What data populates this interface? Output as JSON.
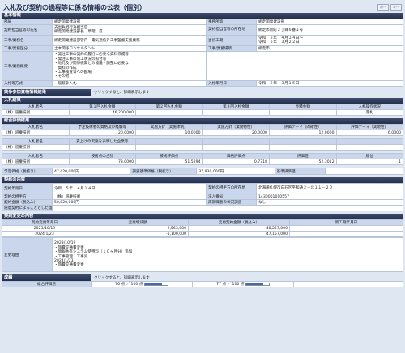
{
  "header": {
    "title": "入札及び契約の過程等に係る情報の公表（個別）",
    "prev_label": "前へ",
    "next_label": "次へ"
  },
  "basic_info": {
    "section_title": "基本情報",
    "bureau_label": "部局",
    "bureau_value": "網走開発建設部",
    "office_label": "事務所等",
    "office_value": "網走開発建設部",
    "official_label": "契約担当官等の氏名",
    "official_value": "支出負担行為担当官\n網走開発建設部長　草階　忍",
    "address_label": "契約担当官等の所在地",
    "address_value": "網走市新町２丁目６番１号",
    "work_name_label": "工事/業務名",
    "work_name_value": "網走開発建設部管内　電気通信外工事監督支援業務",
    "period_label": "当初工期",
    "period_value": "令和　５年　４月１４日～\n令和　６年　３月２２日",
    "type_label": "工事/業務区分",
    "type_value": "土木関係コンサルタント",
    "place_label": "工事/業務場所",
    "place_value": "網走市",
    "outline_label": "工事/業務概要",
    "outline_items": [
      "・発注工事の契約の履行に必要な資料作成等",
      "・発注工事の施工状況の照合等",
      "・地元及び関係機関との協議・調整に必要な",
      "　資料の作成",
      "・工事検査等への臨場",
      "・その他"
    ],
    "bid_method_label": "入札等方式",
    "bid_method_value": "一般競争入札",
    "bid_date_label": "入札年月日",
    "bid_date_value": "令和　５年　３月１５日"
  },
  "competition": {
    "section_title": "競争参加資格情報結果",
    "note": "クリックすると、詳細表示します"
  },
  "bid_results": {
    "section_title": "入札結果",
    "headers": [
      "入札者名",
      "第１回入札金額",
      "第２回入札金額",
      "第３回入札金額",
      "見積金額",
      "入札操作状況"
    ],
    "rows": [
      [
        "（株）道慶技術",
        "46,200,000",
        "",
        "",
        "",
        "落札"
      ]
    ]
  },
  "eval_results": {
    "section_title": "総合評価結果",
    "table1_headers": [
      "入札者名",
      "予定技術者の資格及び経験等",
      "実施方針（実施体制）",
      "実施方針（業務特性）",
      "評価テーマ（的確性）",
      "評価テーマ（実現性）"
    ],
    "table1_rows": [
      [
        "（株）道慶技術",
        "20.0000",
        "10.0000",
        "20.0000",
        "12.0000",
        "6.0000"
      ]
    ],
    "table2_headers": [
      "入札者名",
      "賃上げの実施を表明した企業等",
      "",
      "",
      "",
      ""
    ],
    "table2_rows": [
      [
        "（株）道慶技術",
        "",
        "",
        "",
        "",
        ""
      ]
    ],
    "table3_headers": [
      "入札者名",
      "技術点の合計",
      "技術評価点",
      "価格評価点",
      "評価値",
      "順位"
    ],
    "table3_rows": [
      [
        "（株）道慶技術",
        "73.0000",
        "51.5294",
        "0.7718",
        "52.3012",
        "1"
      ]
    ]
  },
  "price_row": {
    "planned_label": "予定価格（税抜き）",
    "planned_value": "47,420,000円",
    "standard_label": "調査基準価格（税抜き）",
    "standard_value": "37,930,000円",
    "base_eval_label": "基準評価値",
    "base_eval_value": ""
  },
  "contract": {
    "section_title": "契約の内容",
    "date_label": "契約年月日",
    "date_value": "令和　５年　４月１４日",
    "party_addr_label": "契約の相手方の所在地",
    "party_addr_value": "北海道札幌市白石区平和通２－北１１－２０",
    "party_label": "契約の相手方",
    "party_value": "（株）道慶技術",
    "corp_no_label": "法人番号",
    "corp_no_value": "1430001010557",
    "amount_label": "契約金額（税込み）",
    "amount_value": "50,820,000円",
    "reemploy_label": "再就職者の状況調査",
    "reemploy_value": "なし",
    "reason_label": "随意契約によることとした理由",
    "reason_value": ""
  },
  "changes": {
    "section_title": "契約変更の内容",
    "headers": [
      "契約変更年月日",
      "変更増減額",
      "変更契約金額（税込み）",
      "新工期年月日"
    ],
    "rows": [
      [
        "2023/10/19",
        "-2,563,000",
        "48,257,000",
        ""
      ],
      [
        "2024/1/23",
        "-1,100,000",
        "47,157,000",
        ""
      ]
    ],
    "reason_label": "変更理由",
    "reason_lines": [
      "2023/10/19",
      "・旅費交通費変更",
      "・情報共有システム使用料（１０ヶ月分）追加",
      "・工事管理１工事減",
      "2024/1/23",
      "・旅費交通費変更"
    ]
  },
  "performance": {
    "section_title": "成績",
    "note": "クリックすると、詳細表示します",
    "row_label": "総合評価点",
    "score1_text": "76 点 ／ 100 点",
    "score1_fraction": 0.76,
    "score2_text": "77 点 ／ 100 点",
    "score2_fraction": 0.77
  }
}
